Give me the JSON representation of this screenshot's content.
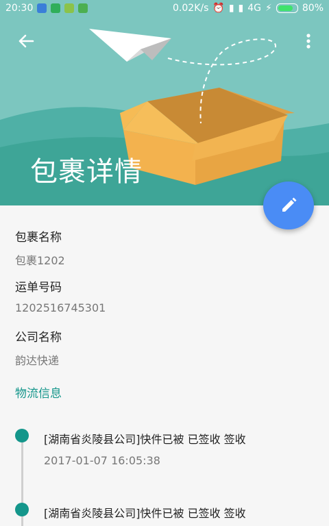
{
  "status_bar": {
    "time": "20:30",
    "network_speed": "0.02K/s",
    "network_type": "4G",
    "battery_percent": "80%",
    "battery_level": 0.8
  },
  "header": {
    "title": "包裹详情",
    "back_icon": "arrow-left-icon",
    "more_icon": "more-vert-icon",
    "edit_icon": "pencil-icon"
  },
  "details": {
    "package_name_label": "包裹名称",
    "package_name_value": "包裹1202",
    "tracking_number_label": "运单号码",
    "tracking_number_value": "1202516745301",
    "company_label": "公司名称",
    "company_value": "韵达快递"
  },
  "logistics": {
    "title": "物流信息",
    "events": [
      {
        "text": "[湖南省炎陵县公司]快件已被 已签收 签收",
        "time": "2017-01-07 16:05:38"
      },
      {
        "text": "[湖南省炎陵县公司]快件已被 已签收 签收",
        "time": ""
      }
    ]
  },
  "colors": {
    "header_bg": "#7cc6bf",
    "accent": "#14968b",
    "fab": "#4a8cf5"
  }
}
